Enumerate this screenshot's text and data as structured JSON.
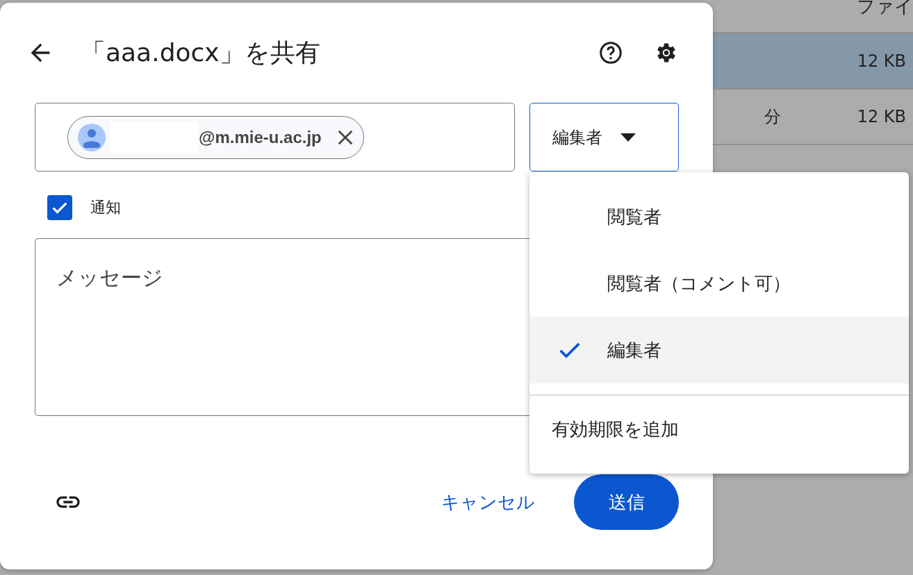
{
  "background_table": {
    "header": "ファイ",
    "rows": [
      {
        "size": "12 KB",
        "selected": true
      },
      {
        "column_1": "分",
        "size": "12 KB",
        "selected": false
      }
    ]
  },
  "dialog": {
    "title": "「aaa.docx」を共有",
    "recipient_chip": {
      "email_suffix": "@m.mie-u.ac.jp"
    },
    "role_dropdown": {
      "value": "編集者",
      "expanded": true
    },
    "notify": {
      "label": "通知",
      "checked": true
    },
    "message": {
      "placeholder": "メッセージ"
    },
    "cancel_button": "キャンセル",
    "send_button": "送信"
  },
  "role_menu": {
    "items": [
      {
        "label": "閲覧者",
        "selected": false
      },
      {
        "label": "閲覧者（コメント可）",
        "selected": false
      },
      {
        "label": "編集者",
        "selected": true
      }
    ],
    "expiry_item": "有効期限を追加"
  }
}
